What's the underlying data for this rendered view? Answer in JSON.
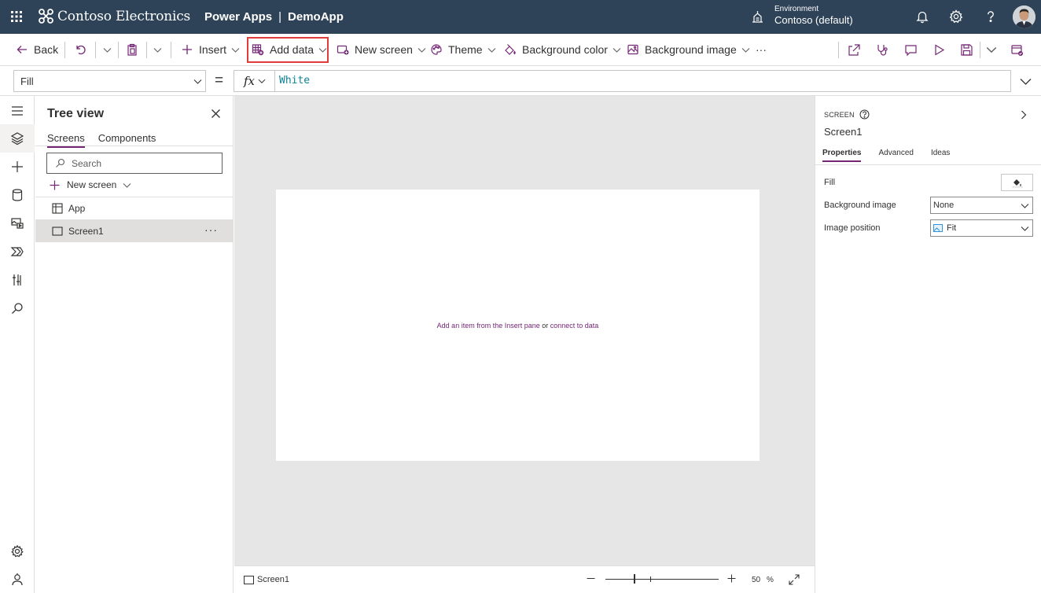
{
  "header": {
    "brand": "Contoso Electronics",
    "product": "Power Apps",
    "separator": "|",
    "app_name": "DemoApp",
    "environment_label": "Environment",
    "environment_name": "Contoso (default)",
    "icons": [
      "waffle-icon",
      "environment-icon",
      "bell-icon",
      "gear-icon",
      "help-icon"
    ],
    "background_color": "#2f4358"
  },
  "commandbar": {
    "back": "Back",
    "insert": "Insert",
    "add_data": "Add data",
    "new_screen": "New screen",
    "theme": "Theme",
    "background_color": "Background color",
    "background_image": "Background image",
    "more": "···",
    "highlight_color": "#e03c3c"
  },
  "formula_bar": {
    "property": "Fill",
    "equals": "=",
    "fx": "fx",
    "formula": "White"
  },
  "tree_view": {
    "title": "Tree view",
    "tabs": [
      "Screens",
      "Components"
    ],
    "selected_tab": "Screens",
    "search_placeholder": "Search",
    "new_screen": "New screen",
    "items": [
      {
        "label": "App",
        "icon": "app-icon"
      },
      {
        "label": "Screen1",
        "icon": "screen-icon",
        "selected": true
      }
    ],
    "more": "···"
  },
  "canvas": {
    "hint_part1": "Add an item from the Insert pane",
    "hint_or": " or ",
    "hint_part2": "connect to data",
    "accent_color": "#742774"
  },
  "statusbar": {
    "screen_name": "Screen1",
    "zoom": "50",
    "zoom_unit": "%"
  },
  "properties_pane": {
    "type": "SCREEN",
    "name": "Screen1",
    "tabs": [
      "Properties",
      "Advanced",
      "Ideas"
    ],
    "selected_tab": "Properties",
    "fill_label": "Fill",
    "background_image_label": "Background image",
    "background_image_value": "None",
    "image_position_label": "Image position",
    "image_position_value": "Fit"
  }
}
